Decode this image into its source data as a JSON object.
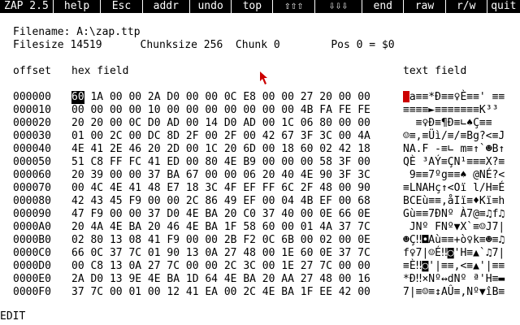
{
  "menubar": {
    "items": [
      {
        "label": "ZAP 2.5",
        "name": "menu-zap-title"
      },
      {
        "label": "help",
        "name": "menu-help"
      },
      {
        "label": "Esc",
        "name": "menu-esc"
      },
      {
        "label": "addr",
        "name": "menu-addr"
      },
      {
        "label": "undo",
        "name": "menu-undo"
      },
      {
        "label": "top",
        "name": "menu-top"
      },
      {
        "label": "⇧⇧⇧",
        "name": "menu-page-up"
      },
      {
        "label": "⇩⇩⇩",
        "name": "menu-page-down"
      },
      {
        "label": "end",
        "name": "menu-end"
      },
      {
        "label": "raw",
        "name": "menu-raw"
      },
      {
        "label": "r/w",
        "name": "menu-rw"
      },
      {
        "label": "quit",
        "name": "menu-quit"
      }
    ]
  },
  "file_info": {
    "filename_line": "Filename: A:\\zap.ttp",
    "filesize_line": "Filesize 14519      Chunksize 256  Chunk 0        Pos 0 = $0"
  },
  "headers": {
    "offset": "offset",
    "hex": "hex field",
    "text": "text field"
  },
  "rows": [
    {
      "offset": "000000",
      "hex": "60 1A 00 00 2A D0 00 00 0C E8 00 00 27 20 00 00",
      "text": "`a≡≡*Ð≡≡♀È≡≡' ≡≡"
    },
    {
      "offset": "000010",
      "hex": "00 00 00 00 10 00 00 00 00 00 00 00 4B FA FE FE",
      "text": "≡≡≡≡►≡≡≡≡≡≡≡K³³"
    },
    {
      "offset": "000020",
      "hec": "",
      "hex": "20 20 00 0C D0 AD 00 14 D0 AD 00 1C 06 80 00 00",
      "text": "  ≡♀Ð­≡¶Ð­≡∟♠Ç≡≡"
    },
    {
      "offset": "000030",
      "hex": "01 00 2C 00 DC 8D 2F 00 2F 00 42 67 3F 3C 00 4A",
      "text": "☺≡,≡Üì/≡/≡Bg?<≡J"
    },
    {
      "offset": "000040",
      "hex": "4E 41 2E 46 20 2D 00 1C 20 6D 00 18 60 02 42 18",
      "text": "NA.F -≡∟ m≡↑`☻B↑"
    },
    {
      "offset": "000050",
      "hex": "51 C8 FF FC 41 ED 00 80 4E B9 00 00 00 58 3F 00",
      "text": "QÈ ³AÝ≡ÇN¹≡≡≡X?≡"
    },
    {
      "offset": "000060",
      "hex": "20 39 00 00 37 BA 67 00 00 06 20 40 4E 90 3F 3C",
      "text": " 9≡≡7ºg≡≡♠ @NÉ?<"
    },
    {
      "offset": "000070",
      "hex": "00 4C 4E 41 48 E7 18 3C 4F EF FF 6C 2F 48 00 90",
      "text": "≡LNAHç↑<Oï l/H≡É"
    },
    {
      "offset": "000080",
      "hex": "42 43 45 F9 00 00 2C 86 49 EF 00 04 4B EF 00 68",
      "text": "BCEù≡≡,åIï≡♦Kï≡h"
    },
    {
      "offset": "000090",
      "hex": "47 F9 00 00 37 D0 4E BA 20 C0 37 40 00 0E 66 0E",
      "text": "Gù≡≡7ÐNº À7@≡♫f♫"
    },
    {
      "offset": "0000A0",
      "hex": "20 4A 4E BA 20 46 4E BA 1F 58 60 00 01 4A 37 7C",
      "text": " JNº FNº▼X`≡☺J7|"
    },
    {
      "offset": "0000B0",
      "hex": "02 80 13 08 41 F9 00 00 2B F2 0C 6B 00 02 00 0E",
      "text": "☻Ç‼◘Aù≡≡+ò♀k≡☻≡♫"
    },
    {
      "offset": "0000C0",
      "hex": "66 0C 37 7C 01 90 13 0A 27 48 00 1E 60 0E 37 7C",
      "text": "f♀7|☺É‼◙'H≡▲`♫7|"
    },
    {
      "offset": "0000D0",
      "hex": "00 C8 13 0A 27 7C 00 00 2C 3C 00 1E 27 7C 00 00",
      "text": "≡È‼◙'|≡≡,<≡▲'|≡≡"
    },
    {
      "offset": "0000E0",
      "hex": "2A D0 13 9E 4E BA 1D 64 4E BA 20 AA 27 48 00 16",
      "text": "*Ð‼×Nº↔dNº ª'H≡▬"
    },
    {
      "offset": "0000F0",
      "hex": "37 7C 00 01 00 12 41 EA 00 2C 4E BA 1F EE 42 00",
      "text": "7|≡☺≡↕AÛ≡,Nº▼îB≡"
    }
  ],
  "status": {
    "mode": "EDIT"
  },
  "colors": {
    "menubar_bg": "#000000",
    "background": "#ffffff",
    "accent": "#cc0000"
  }
}
